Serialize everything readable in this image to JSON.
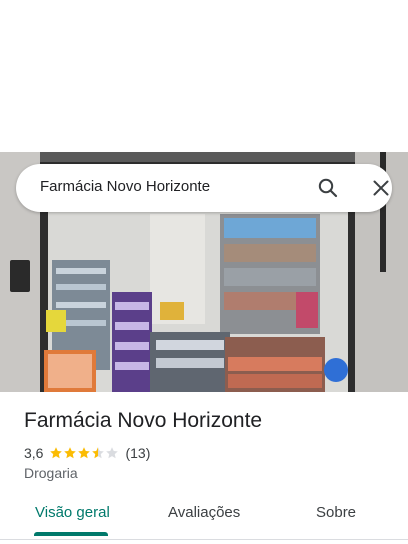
{
  "search": {
    "query": "Farmácia Novo Horizonte"
  },
  "icons": {
    "search": "search-icon",
    "close": "close-icon",
    "star_full": "star-icon",
    "star_half": "star-half-icon",
    "star_empty": "star-empty-icon"
  },
  "place": {
    "name": "Farmácia Novo Horizonte",
    "rating": "3,6",
    "rating_value": 3.6,
    "stars_max": 5,
    "review_count": "(13)",
    "category": "Drogaria"
  },
  "tabs": [
    {
      "label": "Visão geral",
      "active": true
    },
    {
      "label": "Avaliações",
      "active": false
    },
    {
      "label": "Sobre",
      "active": false
    }
  ],
  "colors": {
    "accent": "#00796b",
    "star": "#fbbc04",
    "star_empty": "#dadce0",
    "text_primary": "#202124",
    "text_secondary": "#5f6368"
  }
}
